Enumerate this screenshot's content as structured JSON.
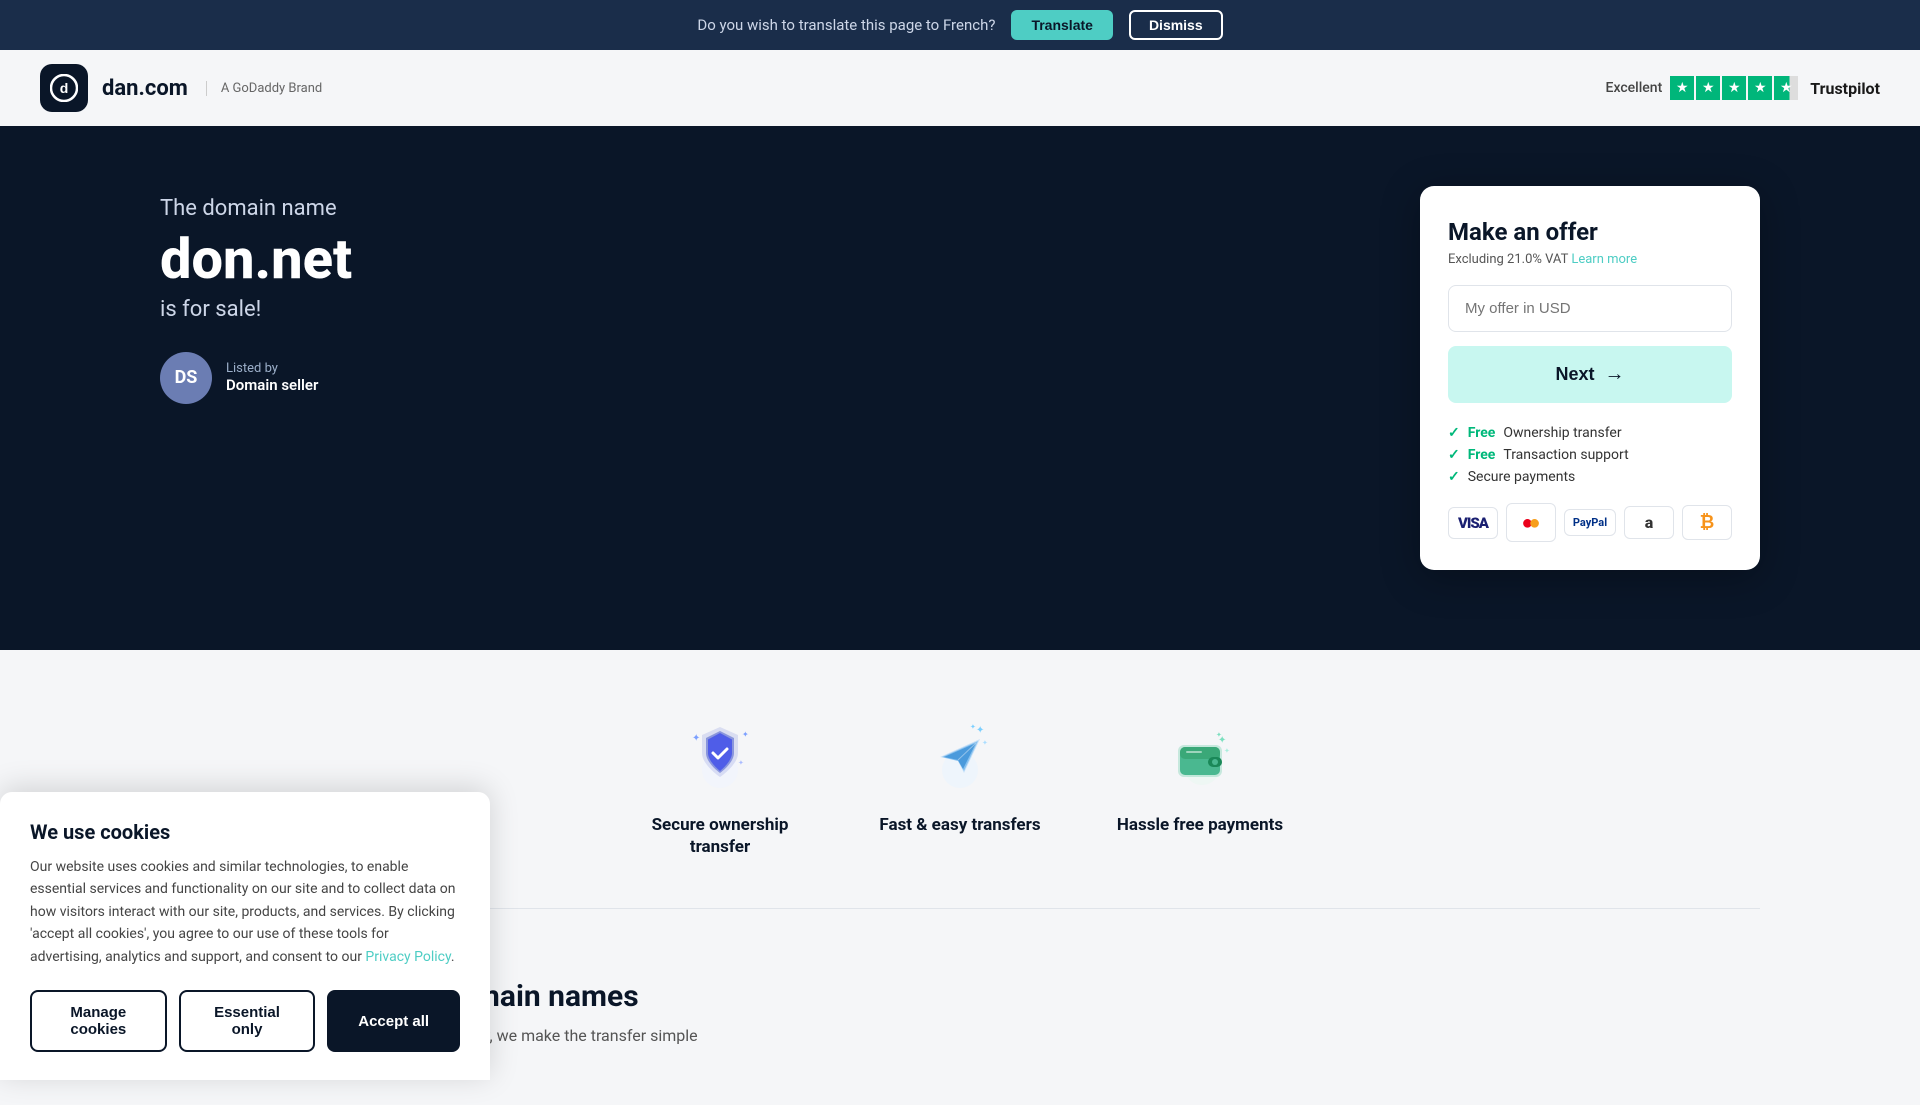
{
  "translate_bar": {
    "message": "Do you wish to translate this page to French?",
    "translate_label": "Translate",
    "dismiss_label": "Dismiss"
  },
  "header": {
    "logo_icon": "⓪",
    "logo_name": "dan.com",
    "logo_brand": "A GoDaddy Brand",
    "trustpilot_label": "Excellent",
    "trustpilot_name": "Trustpilot"
  },
  "hero": {
    "subtitle": "The domain name",
    "domain": "don.net",
    "forsale": "is for sale!",
    "listed_by": "Listed by",
    "seller_name": "Domain seller",
    "seller_initials": "DS"
  },
  "offer_card": {
    "title": "Make an offer",
    "vat_text": "Excluding 21.0% VAT",
    "learn_more": "Learn more",
    "input_placeholder": "My offer in USD",
    "next_label": "Next",
    "features": [
      {
        "label": "Ownership transfer",
        "free": true
      },
      {
        "label": "Transaction support",
        "free": true
      },
      {
        "label": "Secure payments",
        "free": false
      }
    ],
    "payment_icons": [
      {
        "name": "visa",
        "label": "VISA"
      },
      {
        "name": "mastercard",
        "label": "●●"
      },
      {
        "name": "paypal",
        "label": "PayPal"
      },
      {
        "name": "amazon",
        "label": "a"
      },
      {
        "name": "bitcoin",
        "label": "₿"
      }
    ]
  },
  "features": [
    {
      "id": "secure",
      "label": "Secure ownership\ntransfer",
      "icon": "shield"
    },
    {
      "id": "fast",
      "label": "Fast & easy\ntransfers",
      "icon": "plane"
    },
    {
      "id": "hassle",
      "label": "Hassle free\npayments",
      "icon": "wallet"
    }
  ],
  "buy_section": {
    "title": "The easy way to buy domain names",
    "text": "When you find a domain name you want to buy, we make the transfer simple"
  },
  "cookie_banner": {
    "title": "We use cookies",
    "text": "Our website uses cookies and similar technologies, to enable essential services and functionality on our site and to collect data on how visitors interact with our site, products, and services. By clicking 'accept all cookies', you agree to our use of these tools for advertising, analytics and support, and consent to our ",
    "privacy_label": "Privacy Policy",
    "manage_label": "Manage cookies",
    "essential_label": "Essential only",
    "accept_label": "Accept all"
  }
}
